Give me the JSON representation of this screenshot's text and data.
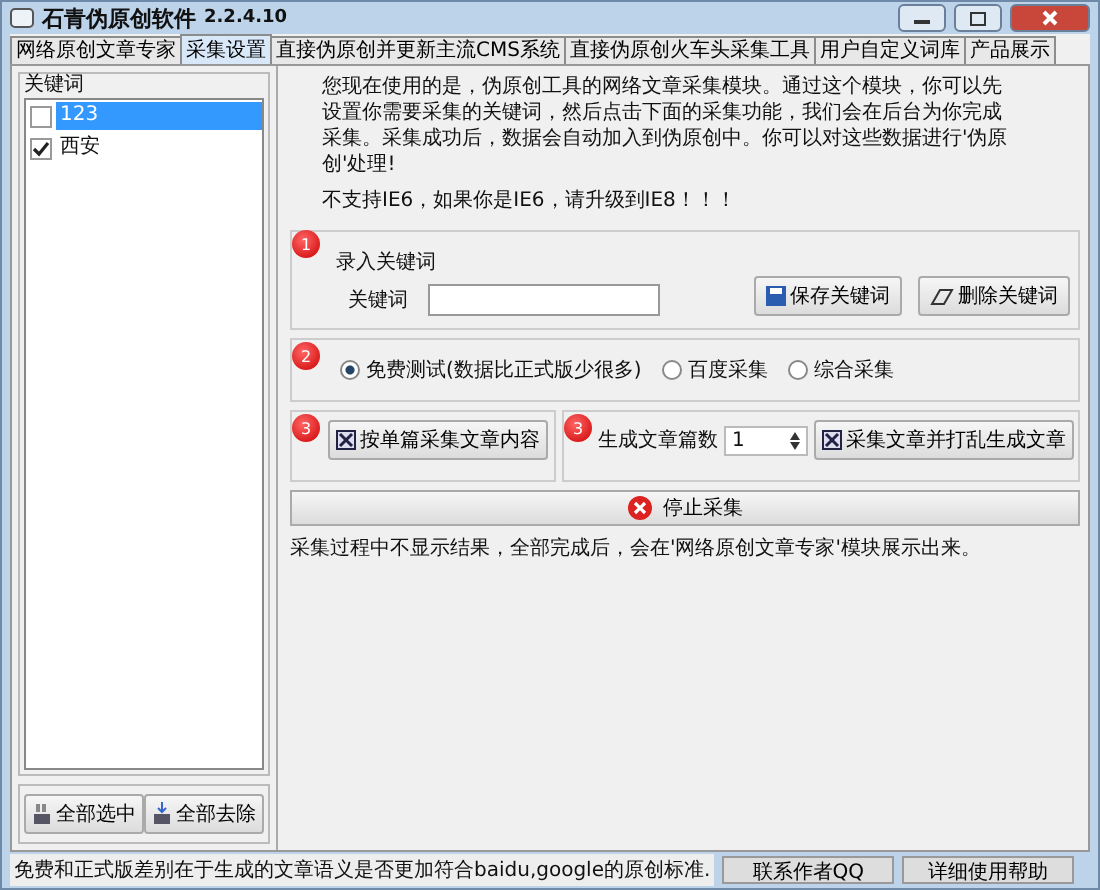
{
  "window": {
    "title": "石青伪原创软件",
    "version": "2.2.4.10"
  },
  "tabs": [
    {
      "label": "网络原创文章专家",
      "selected": false
    },
    {
      "label": "采集设置",
      "selected": true
    },
    {
      "label": "直接伪原创并更新主流CMS系统",
      "selected": false
    },
    {
      "label": "直接伪原创火车头采集工具",
      "selected": false
    },
    {
      "label": "用户自定义词库",
      "selected": false
    },
    {
      "label": "产品展示",
      "selected": false
    }
  ],
  "keyword_panel": {
    "title": "关键词",
    "items": [
      {
        "label": "123",
        "checked": false,
        "selected": true
      },
      {
        "label": "西安",
        "checked": true,
        "selected": false
      }
    ],
    "buttons": [
      {
        "label": "全部选中",
        "kind": "select"
      },
      {
        "label": "全部去除",
        "kind": "clear"
      }
    ]
  },
  "intro": "您现在使用的是，伪原创工具的网络文章采集模块。通过这个模块，你可以先设置你需要采集的关键词，然后点击下面的采集功能，我们会在后台为你完成采集。采集成功后，数据会自动加入到伪原创中。你可以对这些数据进行'伪原创'处理!",
  "warning": "不支持IE6，如果你是IE6，请升级到IE8！！！",
  "step1": {
    "badge": "1",
    "title": "录入关键词",
    "field_label": "关键词",
    "buttons": [
      {
        "label": "保存关键词",
        "kind": "save"
      },
      {
        "label": "删除关键词",
        "kind": "erase"
      }
    ]
  },
  "step2": {
    "badge": "2",
    "options": [
      {
        "label": "免费测试(数据比正式版少很多)",
        "selected": true
      },
      {
        "label": "百度采集",
        "selected": false
      },
      {
        "label": "综合采集",
        "selected": false
      }
    ]
  },
  "step3a": {
    "badge": "3",
    "button": "按单篇采集文章内容"
  },
  "step3b": {
    "badge": "3",
    "label": "生成文章篇数",
    "value": "1",
    "button": "采集文章并打乱生成文章"
  },
  "stop_button": "停止采集",
  "note": "采集过程中不显示结果，全部完成后，会在'网络原创文章专家'模块展示出来。",
  "status_bar": {
    "text": "免费和正式版差别在于生成的文章语义是否更加符合baidu,google的原创标准.",
    "buttons": [
      "联系作者QQ",
      "详细使用帮助"
    ]
  }
}
